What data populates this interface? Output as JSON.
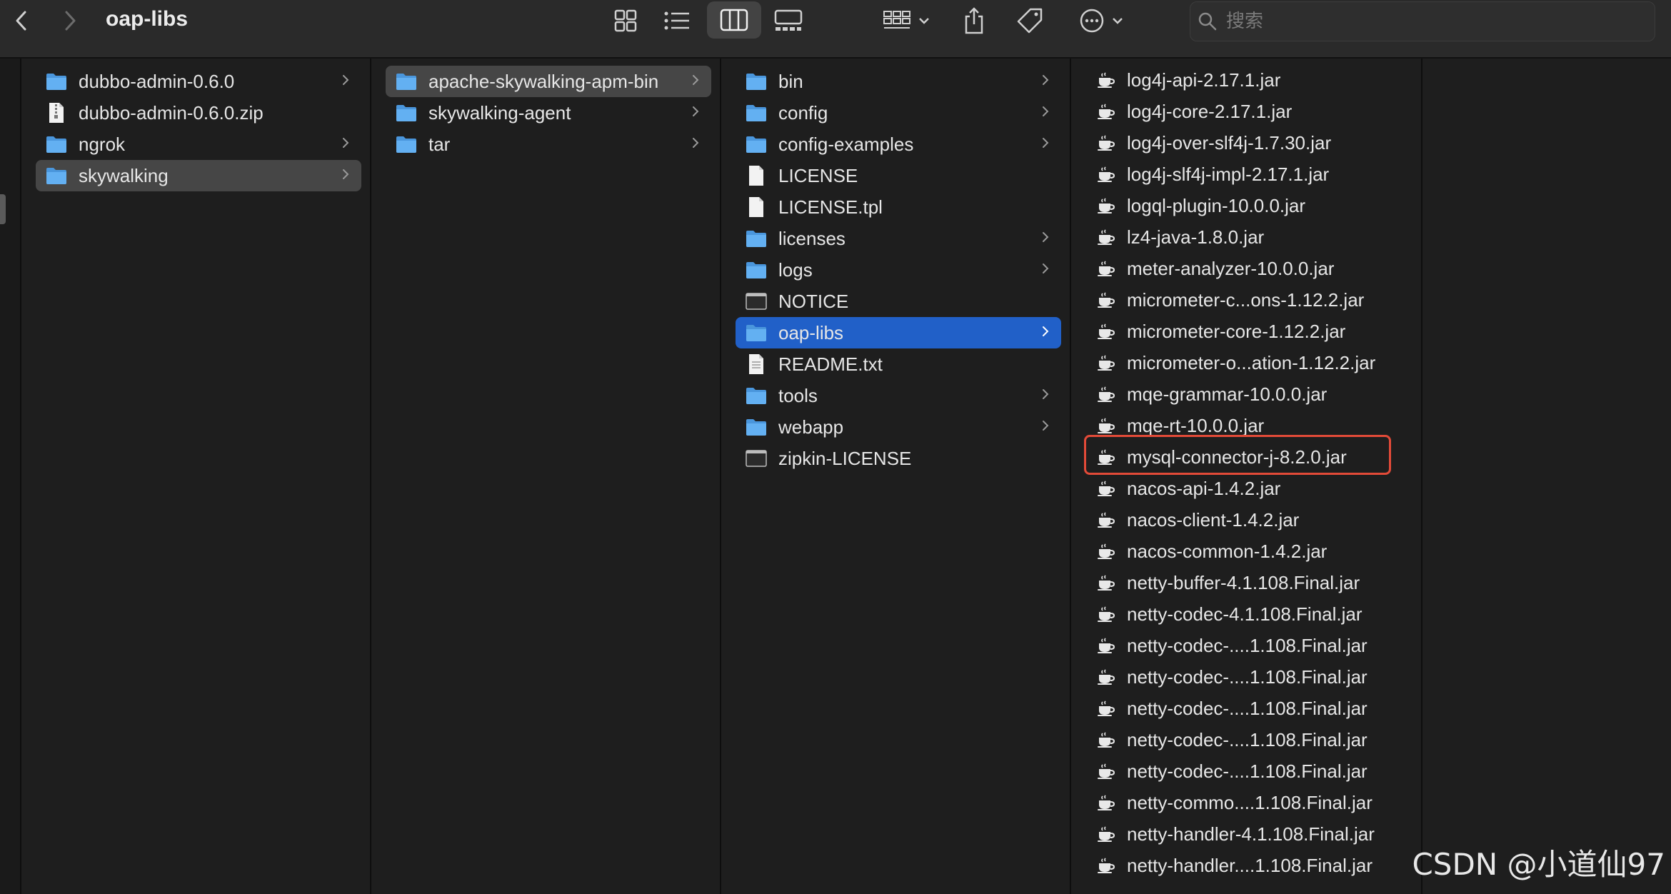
{
  "window": {
    "title": "oap-libs",
    "search_placeholder": "搜索"
  },
  "toolbar": {
    "back": "back-icon",
    "forward": "forward-icon",
    "views": [
      "icon-view",
      "list-view",
      "column-view",
      "gallery-view"
    ],
    "active_view": "column-view"
  },
  "colors": {
    "background": "#1e1e1e",
    "selection_blue": "#2160c8",
    "selection_gray": "#464646",
    "folder_blue": "#5aa9ef",
    "highlight_red": "#e24a38"
  },
  "column1": {
    "items": [
      {
        "label": "dubbo-admin-0.6.0",
        "icon": "folder-icon",
        "has_children": true
      },
      {
        "label": "dubbo-admin-0.6.0.zip",
        "icon": "zip-file-icon",
        "has_children": false
      },
      {
        "label": "ngrok",
        "icon": "folder-icon",
        "has_children": true
      },
      {
        "label": "skywalking",
        "icon": "folder-icon",
        "has_children": true,
        "selected": true
      }
    ]
  },
  "column2": {
    "items": [
      {
        "label": "apache-skywalking-apm-bin",
        "icon": "folder-icon",
        "has_children": true,
        "selected": true
      },
      {
        "label": "skywalking-agent",
        "icon": "folder-icon",
        "has_children": true
      },
      {
        "label": "tar",
        "icon": "folder-icon",
        "has_children": true
      }
    ]
  },
  "column3": {
    "items": [
      {
        "label": "bin",
        "icon": "folder-icon",
        "has_children": true
      },
      {
        "label": "config",
        "icon": "folder-icon",
        "has_children": true
      },
      {
        "label": "config-examples",
        "icon": "folder-icon",
        "has_children": true
      },
      {
        "label": "LICENSE",
        "icon": "document-icon",
        "has_children": false
      },
      {
        "label": "LICENSE.tpl",
        "icon": "document-icon",
        "has_children": false
      },
      {
        "label": "licenses",
        "icon": "folder-icon",
        "has_children": true
      },
      {
        "label": "logs",
        "icon": "folder-icon",
        "has_children": true
      },
      {
        "label": "NOTICE",
        "icon": "terminal-file-icon",
        "has_children": false
      },
      {
        "label": "oap-libs",
        "icon": "folder-icon",
        "has_children": true,
        "selected": true,
        "active": true
      },
      {
        "label": "README.txt",
        "icon": "text-file-icon",
        "has_children": false
      },
      {
        "label": "tools",
        "icon": "folder-icon",
        "has_children": true
      },
      {
        "label": "webapp",
        "icon": "folder-icon",
        "has_children": true
      },
      {
        "label": "zipkin-LICENSE",
        "icon": "terminal-file-icon",
        "has_children": false
      }
    ]
  },
  "column4": {
    "items": [
      {
        "label": "log4j-api-2.17.1.jar",
        "icon": "jar-icon"
      },
      {
        "label": "log4j-core-2.17.1.jar",
        "icon": "jar-icon"
      },
      {
        "label": "log4j-over-slf4j-1.7.30.jar",
        "icon": "jar-icon"
      },
      {
        "label": "log4j-slf4j-impl-2.17.1.jar",
        "icon": "jar-icon"
      },
      {
        "label": "logql-plugin-10.0.0.jar",
        "icon": "jar-icon"
      },
      {
        "label": "lz4-java-1.8.0.jar",
        "icon": "jar-icon"
      },
      {
        "label": "meter-analyzer-10.0.0.jar",
        "icon": "jar-icon"
      },
      {
        "label": "micrometer-c...ons-1.12.2.jar",
        "icon": "jar-icon"
      },
      {
        "label": "micrometer-core-1.12.2.jar",
        "icon": "jar-icon"
      },
      {
        "label": "micrometer-o...ation-1.12.2.jar",
        "icon": "jar-icon"
      },
      {
        "label": "mqe-grammar-10.0.0.jar",
        "icon": "jar-icon"
      },
      {
        "label": "mqe-rt-10.0.0.jar",
        "icon": "jar-icon"
      },
      {
        "label": "mysql-connector-j-8.2.0.jar",
        "icon": "jar-icon",
        "highlighted": true
      },
      {
        "label": "nacos-api-1.4.2.jar",
        "icon": "jar-icon"
      },
      {
        "label": "nacos-client-1.4.2.jar",
        "icon": "jar-icon"
      },
      {
        "label": "nacos-common-1.4.2.jar",
        "icon": "jar-icon"
      },
      {
        "label": "netty-buffer-4.1.108.Final.jar",
        "icon": "jar-icon"
      },
      {
        "label": "netty-codec-4.1.108.Final.jar",
        "icon": "jar-icon"
      },
      {
        "label": "netty-codec-....1.108.Final.jar",
        "icon": "jar-icon"
      },
      {
        "label": "netty-codec-....1.108.Final.jar",
        "icon": "jar-icon"
      },
      {
        "label": "netty-codec-....1.108.Final.jar",
        "icon": "jar-icon"
      },
      {
        "label": "netty-codec-....1.108.Final.jar",
        "icon": "jar-icon"
      },
      {
        "label": "netty-codec-....1.108.Final.jar",
        "icon": "jar-icon"
      },
      {
        "label": "netty-commo....1.108.Final.jar",
        "icon": "jar-icon"
      },
      {
        "label": "netty-handler-4.1.108.Final.jar",
        "icon": "jar-icon"
      },
      {
        "label": "netty-handler....1.108.Final.jar",
        "icon": "jar-icon"
      }
    ]
  },
  "watermark": "CSDN @小道仙97"
}
